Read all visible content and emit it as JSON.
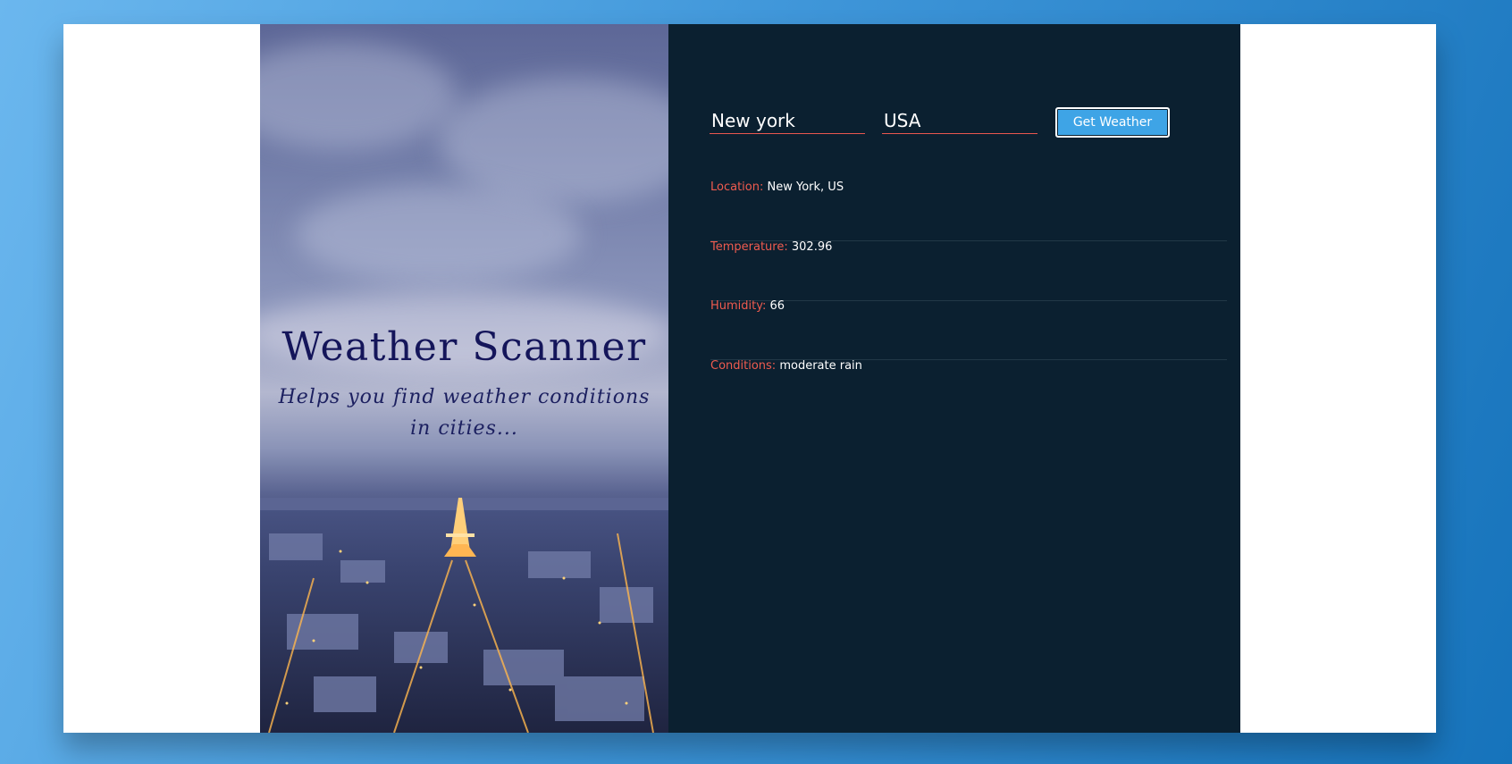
{
  "hero": {
    "title": "Weather Scanner",
    "subtitle": "Helps you find weather conditions in cities..."
  },
  "form": {
    "city_value": "New york",
    "country_value": "USA",
    "submit_label": "Get Weather"
  },
  "results": [
    {
      "label": "Location:",
      "value": "New York, US"
    },
    {
      "label": "Temperature:",
      "value": "302.96"
    },
    {
      "label": "Humidity:",
      "value": "66"
    },
    {
      "label": "Conditions:",
      "value": "moderate rain"
    }
  ],
  "colors": {
    "accent": "#e8564f",
    "button": "#3ea4e6",
    "panel": "#0b2030",
    "title": "#14155a"
  }
}
